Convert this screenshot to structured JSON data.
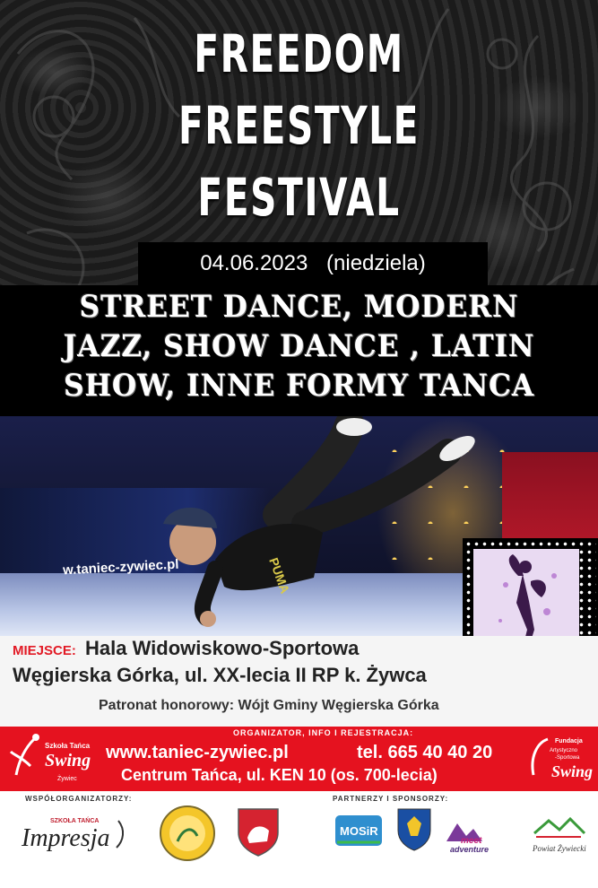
{
  "title": {
    "line1": "FREEDOM",
    "line2": "FREESTYLE",
    "line3": "FESTIVAL"
  },
  "date": {
    "value": "04.06.2023",
    "day": "(niedziela)"
  },
  "genres": {
    "line1": "STREET DANCE, MODERN",
    "line2": "JAZZ, SHOW DANCE , LATIN",
    "line3": "SHOW, INNE FORMY TANCA"
  },
  "photo": {
    "banner_text": "w.taniec-zywiec.pl"
  },
  "venue": {
    "label": "MIEJSCE:",
    "name": "Hala Widowiskowo-Sportowa",
    "address": "Węgierska Górka, ul. XX-lecia II RP k. Żywca",
    "patron": "Patronat honorowy: Wójt Gminy Węgierska Górka"
  },
  "organizer": {
    "label": "ORGANIZATOR, INFO I REJESTRACJA:",
    "website": "www.taniec-zywiec.pl",
    "phone": "tel. 665 40 40 20",
    "address": "Centrum Tańca, ul. KEN 10 (os. 700-lecia)",
    "logo_left_text": "Szkoła Tańca Swing Żywiec",
    "logo_right_text": "Fundacja Artystyczno-Sportowa Swing"
  },
  "sponsors": {
    "co_label": "WSPÓŁORGANIZATORZY:",
    "partner_label": "PARTNERZY I SPONSORZY:",
    "impresja": "Impresja",
    "impresja_small": "SZKOŁA TAŃCA",
    "mosir": "MOSiR",
    "meet": "meet adventure",
    "powiat": "Powiat Żywiecki"
  },
  "colors": {
    "red": "#e5121f",
    "dark": "#111111",
    "white": "#ffffff"
  }
}
